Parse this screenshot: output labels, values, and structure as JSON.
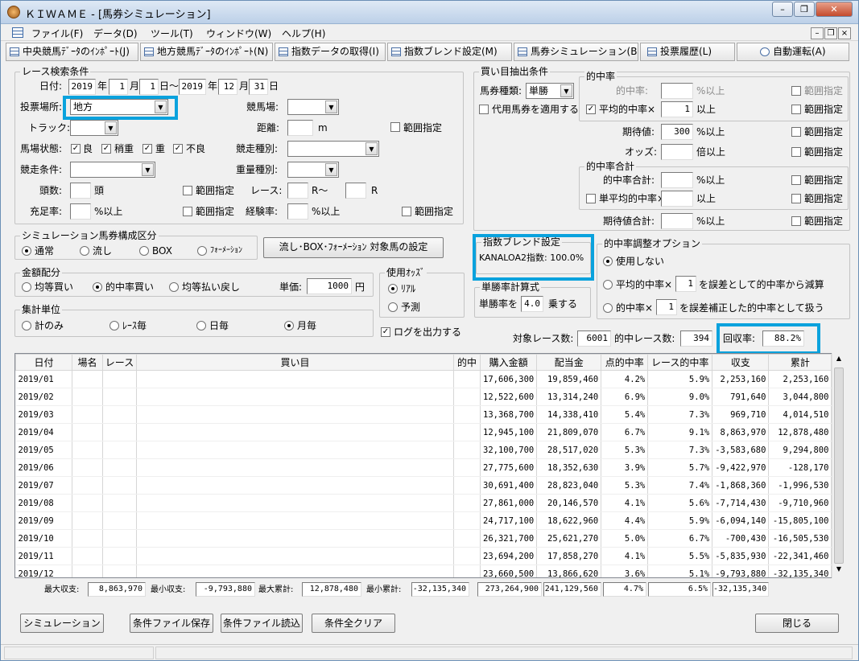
{
  "window": {
    "title": "ＫＩＷＡＭＥ - [馬券シミュレーション]",
    "minimize": "–",
    "restore": "❐",
    "close": "✕"
  },
  "menu": [
    "ファイル(F)",
    "データ(D)",
    "ツール(T)",
    "ウィンドウ(W)",
    "ヘルプ(H)"
  ],
  "mdi": {
    "min": "–",
    "restore": "❐",
    "close": "×"
  },
  "toolbar": [
    "中央競馬ﾃﾞｰﾀのｲﾝﾎﾟｰﾄ(J)",
    "地方競馬ﾃﾞｰﾀのｲﾝﾎﾟｰﾄ(N)",
    "指数データの取得(I)",
    "指数ブレンド設定(M)",
    "馬券シミュレーション(B)",
    "投票履歴(L)",
    "自動運転(A)"
  ],
  "race": {
    "legend": "レース検索条件",
    "date_label": "日付:",
    "from_year": "2019",
    "year1": "年",
    "from_month": "1",
    "month1": "月",
    "from_day": "1",
    "day1": "日～",
    "to_year": "2019",
    "year2": "年",
    "to_month": "12",
    "month2": "月",
    "to_day": "31",
    "day2": "日",
    "venue_label": "投票場所:",
    "venue": "地方",
    "track_label": "競馬場:",
    "surface_label": "トラック:",
    "distance_label": "距離:",
    "distance_unit": "m",
    "range_label": "範囲指定",
    "condition_label": "馬場状態:",
    "cond": [
      "良",
      "稍重",
      "重",
      "不良"
    ],
    "kind_label": "競走種別:",
    "race_cond_label": "競走条件:",
    "weight_label": "重量種別:",
    "heads_label": "頭数:",
    "heads_unit": "頭",
    "race_label": "レース:",
    "race_r": "R～",
    "race_r2": "R",
    "fill_label": "充足率:",
    "fill_unit": "%以上",
    "exp_label": "経験率:",
    "exp_unit": "%以上"
  },
  "bet": {
    "legend": "買い目抽出条件",
    "type_label": "馬券種類:",
    "type": "単勝",
    "substitute": "代用馬券を適用する",
    "hit": {
      "legend": "的中率",
      "rate_label": "的中率:",
      "unit": "%以上",
      "avg_label": "平均的中率×",
      "avg_val": "1",
      "avg_unit": "以上"
    },
    "expect_label": "期待値:",
    "expect_val": "300",
    "odds_label": "オッズ:",
    "odds_unit": "倍以上",
    "sum": {
      "legend": "的中率合計",
      "total_label": "的中率合計:",
      "avg_label": "単平均的中率×",
      "avg_unit": "以上"
    },
    "expect_sum_label": "期待値合計:",
    "range": "範囲指定"
  },
  "composition": {
    "legend": "シミュレーション馬券構成区分",
    "options": [
      "通常",
      "流し",
      "BOX",
      "ﾌｫｰﾒｰｼｮﾝ"
    ],
    "button": "流し･BOX･ﾌｫｰﾒｰｼｮﾝ 対象馬の設定"
  },
  "amount": {
    "legend": "金額配分",
    "options": [
      "均等買い",
      "的中率買い",
      "均等払い戻し"
    ],
    "unit_label": "単価:",
    "unit_val": "1000",
    "unit_yen": "円"
  },
  "odds_used": {
    "legend": "使用ｵｯｽﾞ",
    "options": [
      "ﾘｱﾙ",
      "予測"
    ]
  },
  "tally": {
    "legend": "集計単位",
    "options": [
      "計のみ",
      "ﾚｰｽ毎",
      "日毎",
      "月毎"
    ]
  },
  "log": "ログを出力する",
  "blend": {
    "legend": "指数ブレンド設定",
    "text": "KANALOA2指数: 100.0%"
  },
  "win_calc": {
    "legend": "単勝率計算式",
    "prefix": "単勝率を",
    "val": "4.0",
    "suffix": "乗する"
  },
  "adjust": {
    "legend": "的中率調整オプション",
    "options": [
      "使用しない",
      "平均的中率×",
      "的中率×"
    ],
    "val1": "1",
    "text1": "を誤差として的中率から減算",
    "val2": "1",
    "text2": "を誤差補正した的中率として扱う"
  },
  "stats": {
    "races_label": "対象レース数:",
    "races": "6001",
    "hit_label": "的中レース数:",
    "hit": "394",
    "return_label": "回収率:",
    "return": "88.2%"
  },
  "table": {
    "headers": [
      "日付",
      "場名",
      "レース",
      "買い目",
      "的中",
      "購入金額",
      "配当金",
      "点的中率",
      "レース的中率",
      "収支",
      "累計"
    ],
    "rows": [
      [
        "2019/01",
        "",
        "",
        "",
        "",
        "17,606,300",
        "19,859,460",
        "4.2%",
        "5.9%",
        "2,253,160",
        "2,253,160"
      ],
      [
        "2019/02",
        "",
        "",
        "",
        "",
        "12,522,600",
        "13,314,240",
        "6.9%",
        "9.0%",
        "791,640",
        "3,044,800"
      ],
      [
        "2019/03",
        "",
        "",
        "",
        "",
        "13,368,700",
        "14,338,410",
        "5.4%",
        "7.3%",
        "969,710",
        "4,014,510"
      ],
      [
        "2019/04",
        "",
        "",
        "",
        "",
        "12,945,100",
        "21,809,070",
        "6.7%",
        "9.1%",
        "8,863,970",
        "12,878,480"
      ],
      [
        "2019/05",
        "",
        "",
        "",
        "",
        "32,100,700",
        "28,517,020",
        "5.3%",
        "7.3%",
        "-3,583,680",
        "9,294,800"
      ],
      [
        "2019/06",
        "",
        "",
        "",
        "",
        "27,775,600",
        "18,352,630",
        "3.9%",
        "5.7%",
        "-9,422,970",
        "-128,170"
      ],
      [
        "2019/07",
        "",
        "",
        "",
        "",
        "30,691,400",
        "28,823,040",
        "5.3%",
        "7.4%",
        "-1,868,360",
        "-1,996,530"
      ],
      [
        "2019/08",
        "",
        "",
        "",
        "",
        "27,861,000",
        "20,146,570",
        "4.1%",
        "5.6%",
        "-7,714,430",
        "-9,710,960"
      ],
      [
        "2019/09",
        "",
        "",
        "",
        "",
        "24,717,100",
        "18,622,960",
        "4.4%",
        "5.9%",
        "-6,094,140",
        "-15,805,100"
      ],
      [
        "2019/10",
        "",
        "",
        "",
        "",
        "26,321,700",
        "25,621,270",
        "5.0%",
        "6.7%",
        "-700,430",
        "-16,505,530"
      ],
      [
        "2019/11",
        "",
        "",
        "",
        "",
        "23,694,200",
        "17,858,270",
        "4.1%",
        "5.5%",
        "-5,835,930",
        "-22,341,460"
      ],
      [
        "2019/12",
        "",
        "",
        "",
        "",
        "23,660,500",
        "13,866,620",
        "3.6%",
        "5.1%",
        "-9,793,880",
        "-32,135,340"
      ]
    ]
  },
  "summary": {
    "max_label": "最大収支:",
    "max": "8,863,970",
    "min_label": "最小収支:",
    "min": "-9,793,880",
    "maxc_label": "最大累計:",
    "maxc": "12,878,480",
    "minc_label": "最小累計:",
    "minc": "-32,135,340",
    "buy": "273,264,900",
    "pay": "241,129,560",
    "pt": "4.7%",
    "race": "6.5%",
    "net": "-32,135,340"
  },
  "bottom": {
    "sim": "シミュレーション",
    "save": "条件ファイル保存",
    "load": "条件ファイル読込",
    "clear": "条件全クリア",
    "close": "閉じる"
  }
}
